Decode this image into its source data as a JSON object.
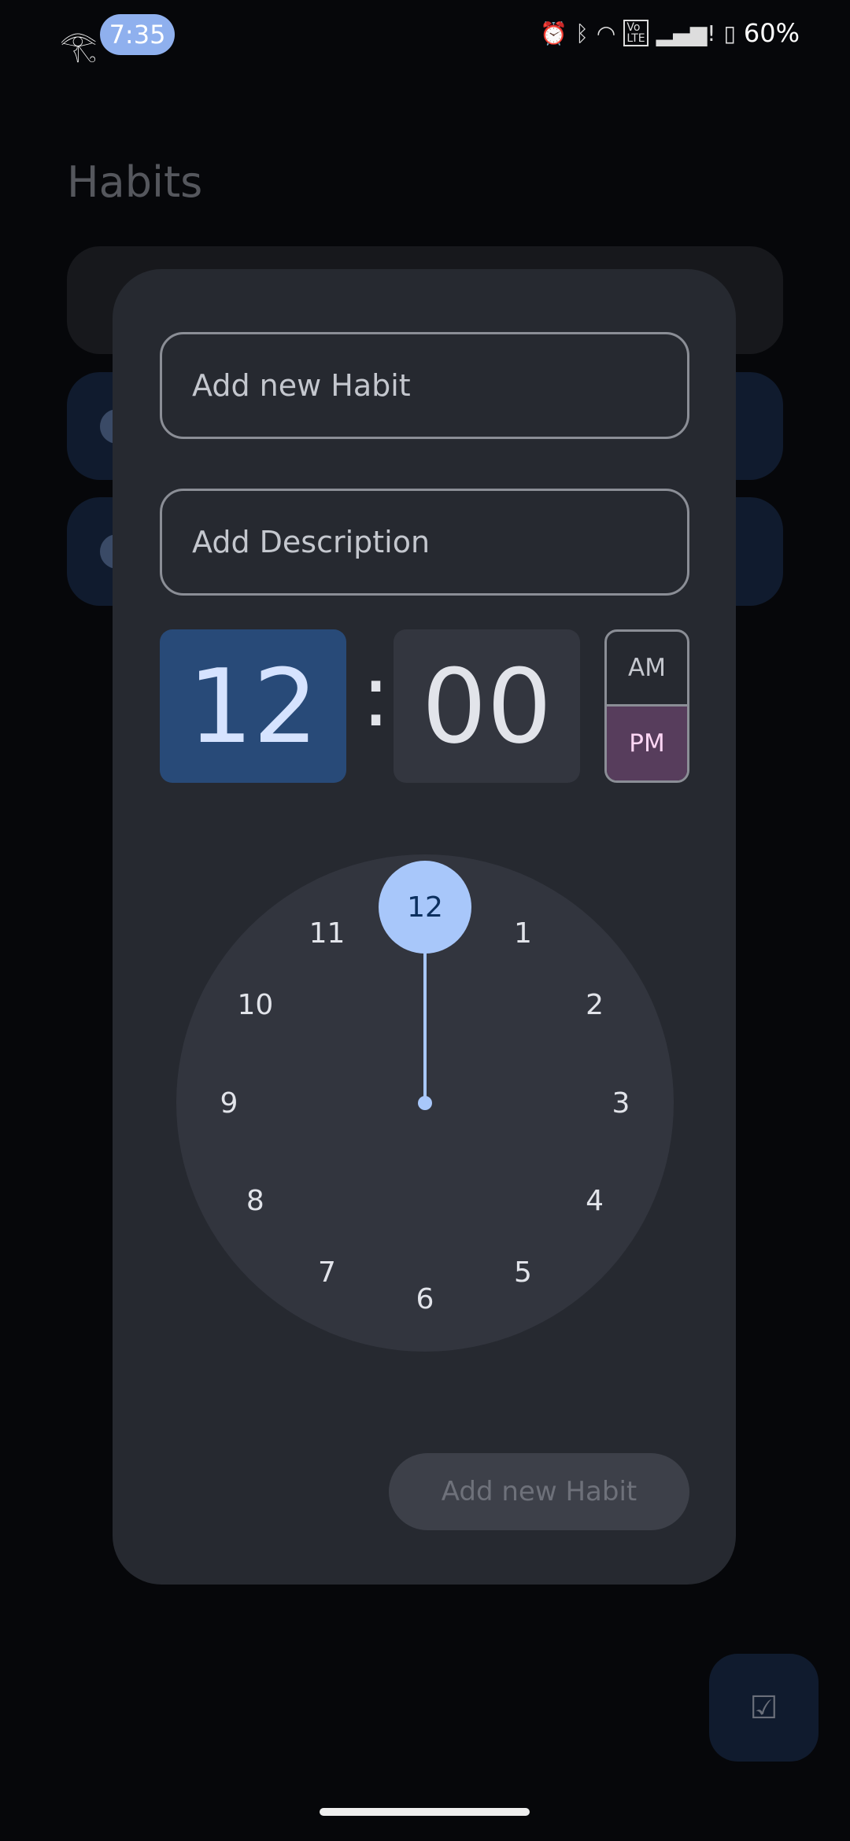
{
  "status_bar": {
    "time": "7:35",
    "battery": "60%",
    "icons": [
      "eye-of-horus-icon",
      "alarm-icon",
      "bluetooth-icon",
      "wifi-icon",
      "volte-icon",
      "signal-icon",
      "battery-charging-icon"
    ]
  },
  "page": {
    "title": "Habits"
  },
  "dialog": {
    "habit_placeholder": "Add new Habit",
    "description_placeholder": "Add Description",
    "time": {
      "hour": "12",
      "separator": ":",
      "minute": "00",
      "am_label": "AM",
      "pm_label": "PM",
      "period_selected": "PM"
    },
    "clock": {
      "numbers": [
        "12",
        "1",
        "2",
        "3",
        "4",
        "5",
        "6",
        "7",
        "8",
        "9",
        "10",
        "11"
      ],
      "selected": "12"
    },
    "submit_label": "Add new Habit"
  },
  "fab": {
    "icon": "checklist-icon"
  },
  "colors": {
    "accent": "#a8c7fa",
    "hour_bg": "#284a78",
    "pm_bg": "#573d5c",
    "dialog_bg": "#262930"
  }
}
